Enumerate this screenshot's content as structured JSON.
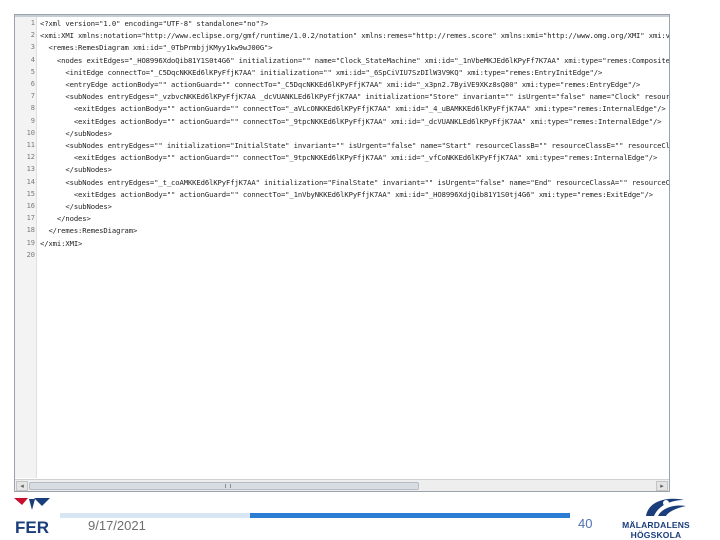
{
  "editor": {
    "lines": [
      {
        "num": "1",
        "text": "<?xml version=\"1.0\" encoding=\"UTF-8\" standalone=\"no\"?>"
      },
      {
        "num": "2",
        "text": "<xmi:XMI xmlns:notation=\"http://www.eclipse.org/gmf/runtime/1.0.2/notation\" xmlns:remes=\"http://remes.score\" xmlns:xmi=\"http://www.omg.org/XMI\" xmi:ver"
      },
      {
        "num": "3",
        "text": "  <remes:RemesDiagram xmi:id=\"_0TbPrmbjjKMyy1kw9wJ00G\">"
      },
      {
        "num": "4",
        "text": "    <nodes exitEdges=\"_HO8996XdoQib81Y1S0t4G6\" initialization=\"\" name=\"Clock_StateMachine\" xmi:id=\"_1nVbeMKJEd6lKPyFf7K7AA\" xmi:type=\"remes:Composite"
      },
      {
        "num": "5",
        "text": "      <initEdge connectTo=\"_C5DqcNKKEd6lKPyFfjK7AA\" initialization=\"\" xmi:id=\"_6SpCiVIU7SzDIlW3V9KQ\" xmi:type=\"remes:EntryInitEdge\"/>"
      },
      {
        "num": "6",
        "text": "      <entryEdge actionBody=\"\" actionGuard=\"\" connectTo=\"_C5DqcNKKEd6lKPyFfjK7AA\" xmi:id=\"_x3pn2.7ByiVE9XKz8sQ80\" xmi:type=\"remes:EntryEdge\"/>"
      },
      {
        "num": "7",
        "text": "      <subNodes entryEdges=\"_vzbvcNKKEd6lKPyFfjK7AA _dcVUANKLEd6lKPyFfjK7AA\" initialization=\"Store\" invariant=\"\" isUrgent=\"false\" name=\"Clock\" resour"
      },
      {
        "num": "8",
        "text": "        <exitEdges actionBody=\"\" actionGuard=\"\" connectTo=\"_aVLcONKKEd6lKPyFfjK7AA\" xmi:id=\"_4_uBAMKKEd6lKPyFfjK7AA\" xmi:type=\"remes:InternalEdge\"/>"
      },
      {
        "num": "9",
        "text": "        <exitEdges actionBody=\"\" actionGuard=\"\" connectTo=\"_9tpcNKKEd6lKPyFfjK7AA\" xmi:id=\"_dcVUANKLEd6lKPyFfjK7AA\" xmi:type=\"remes:InternalEdge\"/>"
      },
      {
        "num": "10",
        "text": "      </subNodes>"
      },
      {
        "num": "11",
        "text": "      <subNodes entryEdges=\"\" initialization=\"InitialState\" invariant=\"\" isUrgent=\"false\" name=\"Start\" resourceClassB=\"\" resourceClassE=\"\" resourceCl"
      },
      {
        "num": "12",
        "text": "        <exitEdges actionBody=\"\" actionGuard=\"\" connectTo=\"_9tpcNKKEd6lKPyFfjK7AA\" xmi:id=\"_vfCoNKKEd6lKPyFfjK7AA\" xmi:type=\"remes:InternalEdge\"/>"
      },
      {
        "num": "13",
        "text": "      </subNodes>"
      },
      {
        "num": "14",
        "text": "      <subNodes entryEdges=\"_t_coAMKKEd6lKPyFfjK7AA\" initialization=\"FinalState\" invariant=\"\" isUrgent=\"false\" name=\"End\" resourceClassA=\"\" resourceCl"
      },
      {
        "num": "15",
        "text": "        <exitEdges actionBody=\"\" actionGuard=\"\" connectTo=\"_1nVbyNKKEd6lKPyFfjK7AA\" xmi:id=\"_HO8996XdjQib81Y1S0tj4G6\" xmi:type=\"remes:ExitEdge\"/>"
      },
      {
        "num": "16",
        "text": "      </subNodes>"
      },
      {
        "num": "17",
        "text": "    </nodes>"
      },
      {
        "num": "18",
        "text": "  </remes:RemesDiagram>"
      },
      {
        "num": "19",
        "text": "</xmi:XMI>"
      },
      {
        "num": "20",
        "text": ""
      }
    ],
    "scroll_left_glyph": "◂",
    "scroll_right_glyph": "▸"
  },
  "footer": {
    "date": "9/17/2021",
    "page_number": "40",
    "institution": "MÄLARDALENS HÖGSKOLA",
    "logo_text": "FER",
    "bar_color": "#2b7cd3",
    "bar_light_color": "#d8e6f4",
    "accent_red": "#c8102e",
    "accent_navy": "#1a3d7c"
  }
}
